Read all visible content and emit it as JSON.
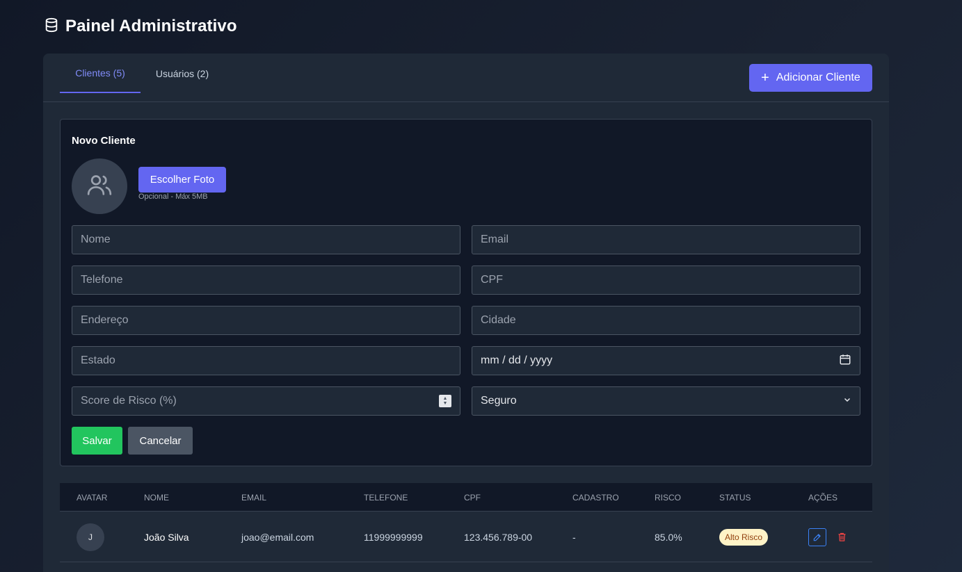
{
  "header": {
    "title": "Painel Administrativo",
    "icon": "database-icon"
  },
  "tabs": [
    {
      "label": "Clientes (5)",
      "active": true
    },
    {
      "label": "Usuários (2)",
      "active": false
    }
  ],
  "add_button": {
    "label": "Adicionar Cliente",
    "icon": "plus-icon"
  },
  "form": {
    "title": "Novo Cliente",
    "photo_button": "Escolher Foto",
    "photo_hint": "Opcional - Máx 5MB",
    "fields": {
      "nome": {
        "placeholder": "Nome"
      },
      "email": {
        "placeholder": "Email"
      },
      "telefone": {
        "placeholder": "Telefone"
      },
      "cpf": {
        "placeholder": "CPF"
      },
      "endereco": {
        "placeholder": "Endereço"
      },
      "cidade": {
        "placeholder": "Cidade"
      },
      "estado": {
        "placeholder": "Estado"
      },
      "data": {
        "placeholder": "mm / dd / yyyy"
      },
      "score": {
        "placeholder": "Score de Risco (%)"
      },
      "status_select": {
        "value": "Seguro"
      }
    },
    "save_button": "Salvar",
    "cancel_button": "Cancelar"
  },
  "table": {
    "headers": [
      "Avatar",
      "Nome",
      "Email",
      "Telefone",
      "CPF",
      "Cadastro",
      "Risco",
      "Status",
      "Ações"
    ],
    "rows": [
      {
        "avatar": "J",
        "nome": "João Silva",
        "email": "joao@email.com",
        "telefone": "11999999999",
        "cpf": "123.456.789-00",
        "cadastro": "-",
        "risco": "85.0%",
        "status": "Alto Risco"
      }
    ]
  },
  "colors": {
    "accent": "#6366f1",
    "success": "#22c55e",
    "danger": "#ef4444",
    "badge_bg": "#fef3c7"
  }
}
